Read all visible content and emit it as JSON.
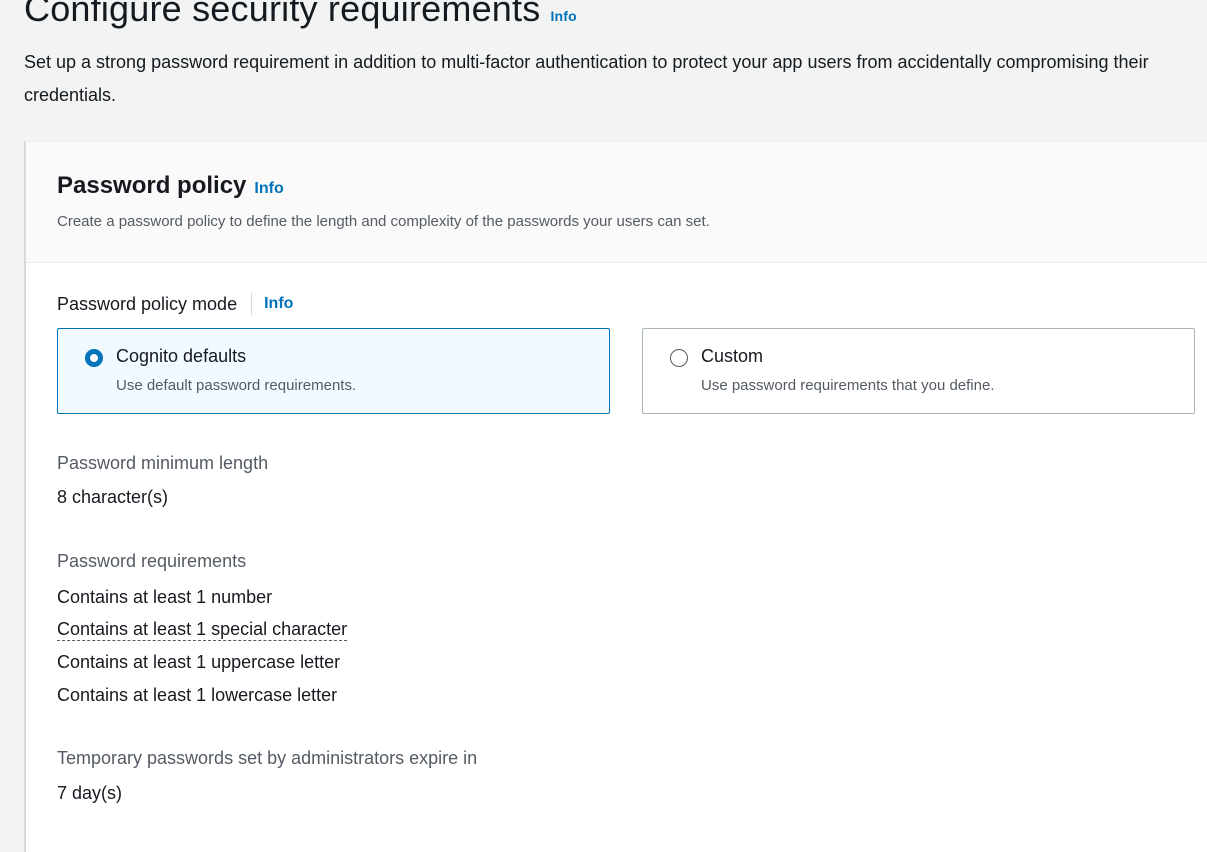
{
  "header": {
    "title": "Configure security requirements",
    "info": "Info",
    "description": "Set up a strong password requirement in addition to multi-factor authentication to protect your app users from accidentally compromising their credentials."
  },
  "panel": {
    "title": "Password policy",
    "info": "Info",
    "description": "Create a password policy to define the length and complexity of the passwords your users can set.",
    "mode_label": "Password policy mode",
    "mode_info": "Info",
    "options": [
      {
        "label": "Cognito defaults",
        "description": "Use default password requirements.",
        "selected": true
      },
      {
        "label": "Custom",
        "description": "Use password requirements that you define.",
        "selected": false
      }
    ],
    "min_length_label": "Password minimum length",
    "min_length_value": "8 character(s)",
    "requirements_label": "Password requirements",
    "requirements": [
      "Contains at least 1 number",
      "Contains at least 1 special character",
      "Contains at least 1 uppercase letter",
      "Contains at least 1 lowercase letter"
    ],
    "temp_label": "Temporary passwords set by administrators expire in",
    "temp_value": "7 day(s)"
  },
  "colors": {
    "accent": "#0073bb",
    "background": "#f2f3f3",
    "selected_tile": "#f1faff"
  }
}
